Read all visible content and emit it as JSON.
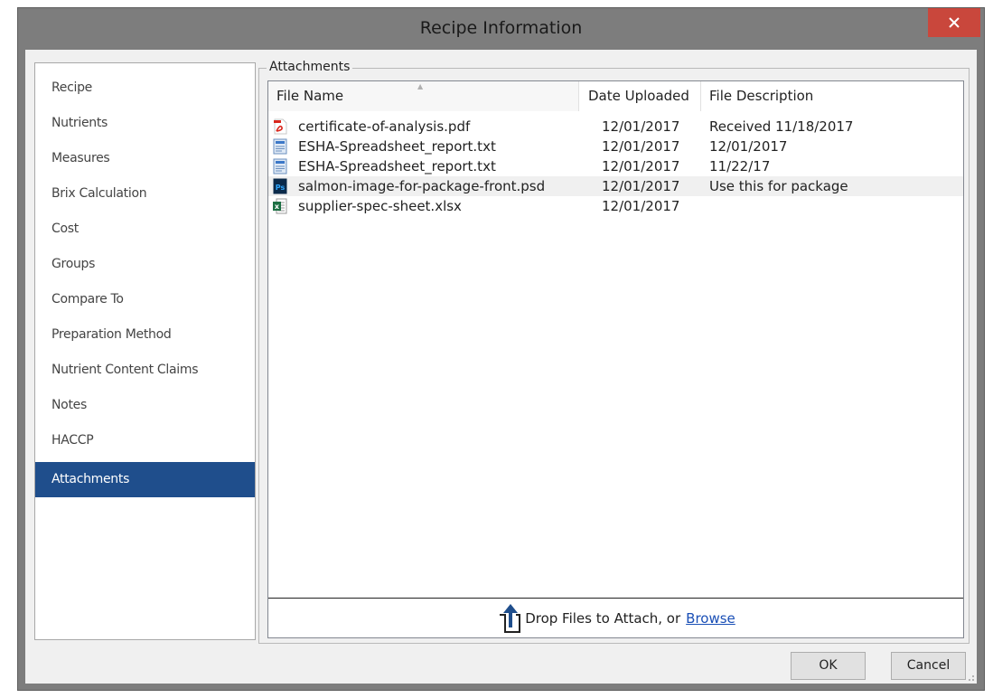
{
  "window": {
    "title": "Recipe Information",
    "close_glyph": "✕",
    "close_color": "#c9473c"
  },
  "sidebar": {
    "items": [
      {
        "label": "Recipe"
      },
      {
        "label": "Nutrients"
      },
      {
        "label": "Measures"
      },
      {
        "label": "Brix Calculation"
      },
      {
        "label": "Cost"
      },
      {
        "label": "Groups"
      },
      {
        "label": "Compare To"
      },
      {
        "label": "Preparation Method"
      },
      {
        "label": "Nutrient Content Claims"
      },
      {
        "label": "Notes"
      },
      {
        "label": "HACCP"
      },
      {
        "label": "Attachments",
        "active": true
      }
    ],
    "active_color": "#1f4e8c"
  },
  "attachments": {
    "group_label": "Attachments",
    "columns": {
      "file_name": "File Name",
      "date_uploaded": "Date Uploaded",
      "file_description": "File Description"
    },
    "sorted_column": "File Name",
    "rows": [
      {
        "icon": "pdf-icon",
        "name": "certificate-of-analysis.pdf",
        "date": "12/01/2017",
        "description": "Received 11/18/2017"
      },
      {
        "icon": "text-file-icon",
        "name": "ESHA-Spreadsheet_report.txt",
        "date": "12/01/2017",
        "description": "12/01/2017"
      },
      {
        "icon": "text-file-icon",
        "name": "ESHA-Spreadsheet_report.txt",
        "date": "12/01/2017",
        "description": "11/22/17"
      },
      {
        "icon": "photoshop-file-icon",
        "name": "salmon-image-for-package-front.psd",
        "date": "12/01/2017",
        "description": "Use this for package",
        "highlighted": true
      },
      {
        "icon": "excel-file-icon",
        "name": "supplier-spec-sheet.xlsx",
        "date": "12/01/2017",
        "description": ""
      }
    ],
    "drop_text": "Drop Files to Attach, or",
    "browse_label": "Browse",
    "link_color": "#1a4fb6"
  },
  "buttons": {
    "ok": "OK",
    "cancel": "Cancel"
  }
}
